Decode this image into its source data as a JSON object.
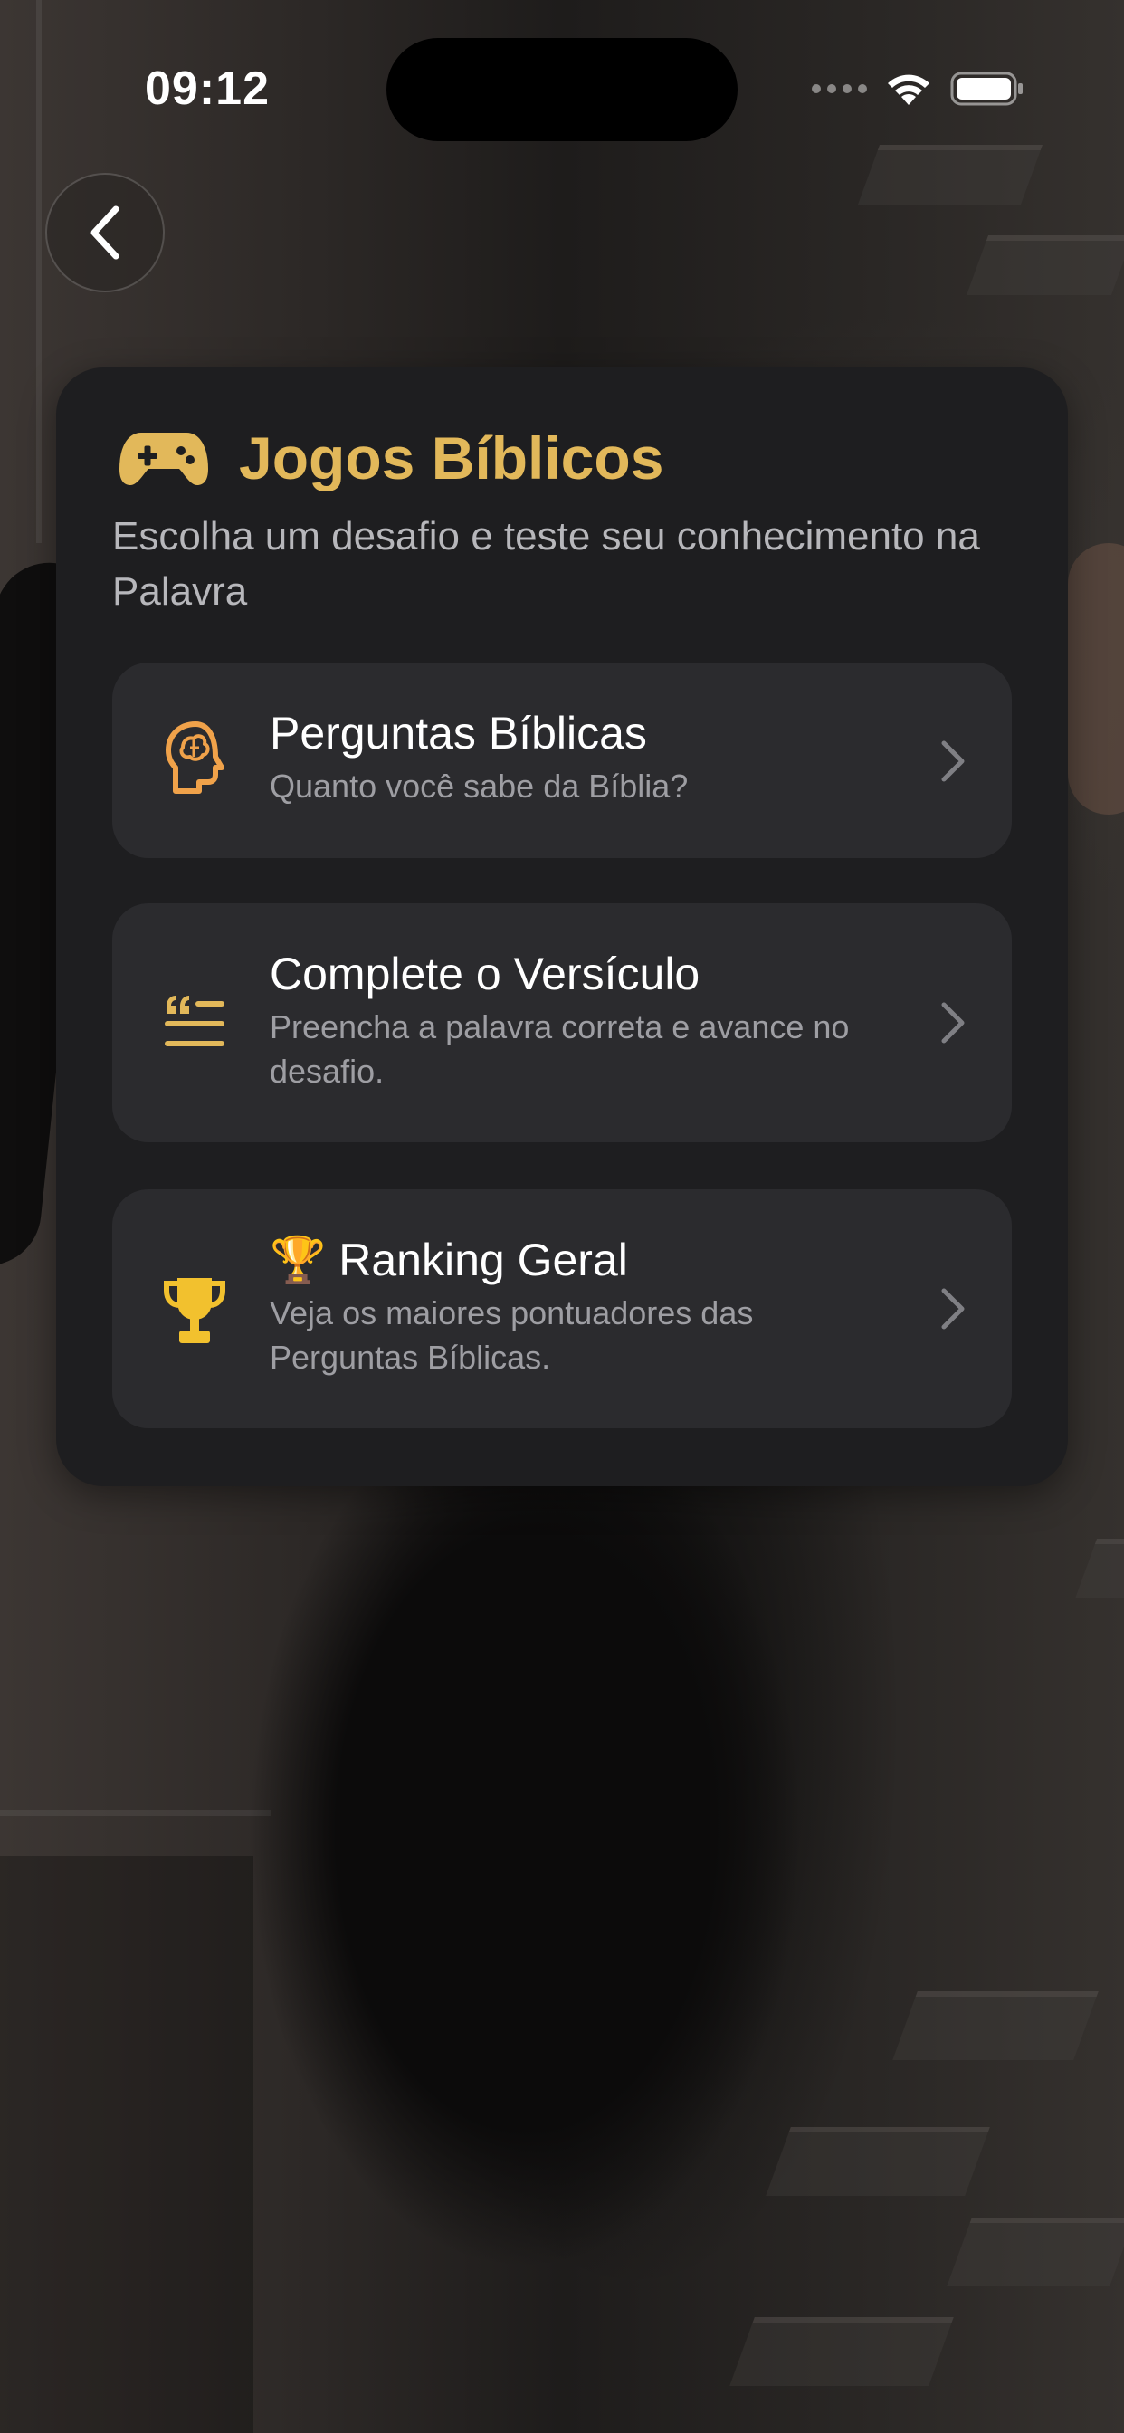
{
  "status_bar": {
    "time": "09:12"
  },
  "navigation": {
    "back_icon": "chevron-left-icon"
  },
  "card": {
    "icon": "gamepad-icon",
    "title": "Jogos Bíblicos",
    "subtitle": "Escolha um desafio e teste seu conhecimento na Palavra",
    "accent_color": "#E2B85A",
    "items": [
      {
        "icon": "brain-head-icon",
        "icon_color": "#F0A24A",
        "title": "Perguntas Bíblicas",
        "description": "Quanto você sabe da Bíblia?"
      },
      {
        "icon": "quote-lines-icon",
        "icon_color": "#E2B85A",
        "title": "Complete o Versículo",
        "description": "Preencha a palavra correta e avance no desafio."
      },
      {
        "icon": "trophy-icon",
        "icon_color": "#F2C12E",
        "title_emoji": "🏆",
        "title": "Ranking Geral",
        "description": "Veja os maiores pontuadores das Perguntas Bíblicas."
      }
    ]
  }
}
